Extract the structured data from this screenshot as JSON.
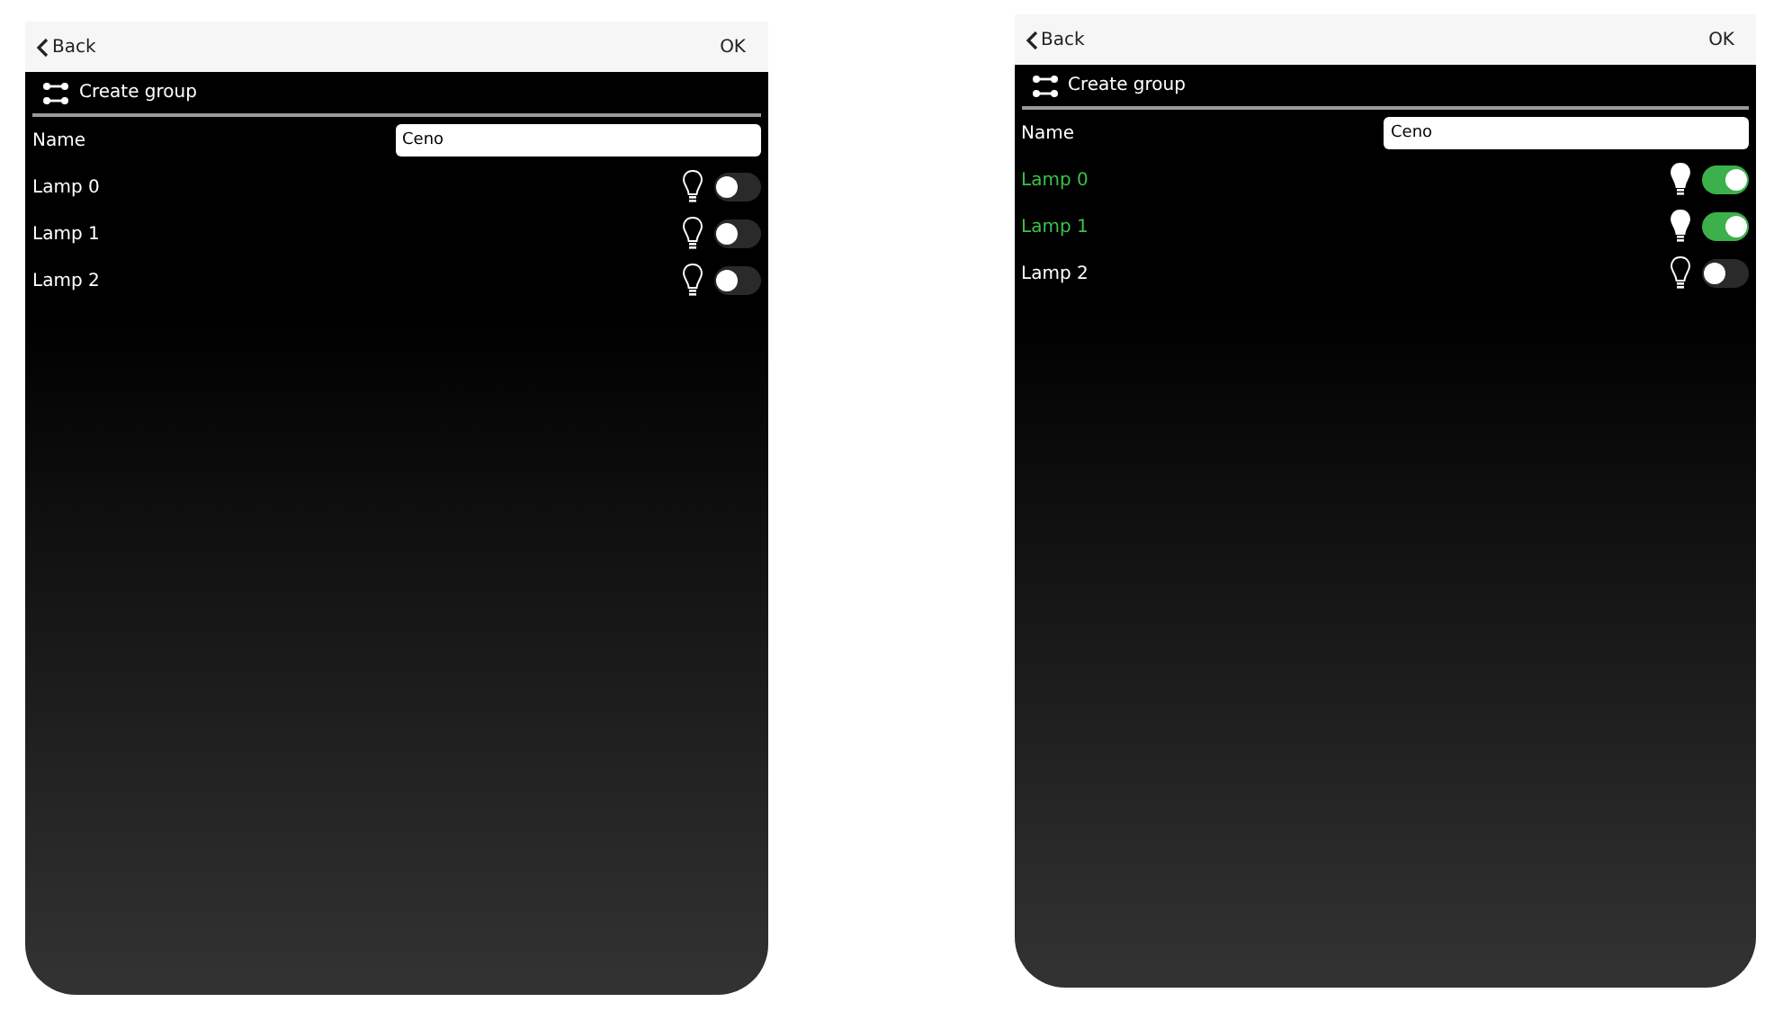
{
  "screens": [
    {
      "back": "Back",
      "ok": "OK",
      "title": "Create group",
      "name_label": "Name",
      "name_value": "Ceno",
      "lamps": [
        {
          "label": "Lamp 0",
          "on": false
        },
        {
          "label": "Lamp 1",
          "on": false
        },
        {
          "label": "Lamp 2",
          "on": false
        }
      ]
    },
    {
      "back": "Back",
      "ok": "OK",
      "title": "Create group",
      "name_label": "Name",
      "name_value": "Ceno",
      "lamps": [
        {
          "label": "Lamp 0",
          "on": true
        },
        {
          "label": "Lamp 1",
          "on": true
        },
        {
          "label": "Lamp 2",
          "on": false
        }
      ]
    }
  ]
}
